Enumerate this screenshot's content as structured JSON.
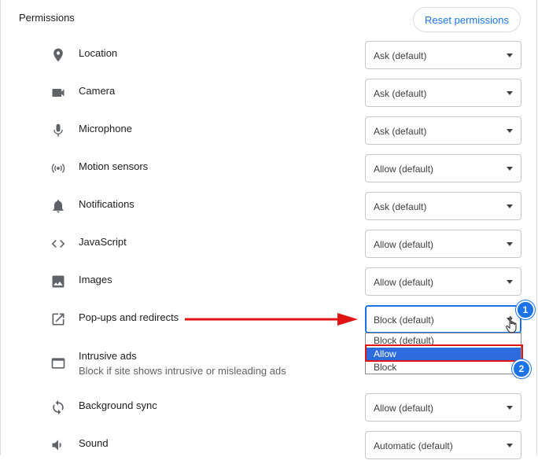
{
  "section": {
    "title": "Permissions",
    "reset_label": "Reset permissions"
  },
  "rows": [
    {
      "label": "Location",
      "value": "Ask (default)",
      "icon": "location-pin-icon"
    },
    {
      "label": "Camera",
      "value": "Ask (default)",
      "icon": "camera-icon"
    },
    {
      "label": "Microphone",
      "value": "Ask (default)",
      "icon": "microphone-icon"
    },
    {
      "label": "Motion sensors",
      "value": "Allow (default)",
      "icon": "motion-sensors-icon"
    },
    {
      "label": "Notifications",
      "value": "Ask (default)",
      "icon": "bell-icon"
    },
    {
      "label": "JavaScript",
      "value": "Allow (default)",
      "icon": "code-icon"
    },
    {
      "label": "Images",
      "value": "Allow (default)",
      "icon": "image-icon"
    },
    {
      "label": "Pop-ups and redirects",
      "value": "Block (default)",
      "icon": "external-link-icon"
    },
    {
      "label": "Intrusive ads",
      "sublabel": "Block if site shows intrusive or misleading ads",
      "icon": "ad-window-icon"
    },
    {
      "label": "Background sync",
      "value": "Allow (default)",
      "icon": "sync-icon"
    },
    {
      "label": "Sound",
      "value": "Automatic (default)",
      "icon": "speaker-icon"
    }
  ],
  "dropdown": {
    "options": [
      "Block (default)",
      "Allow",
      "Block"
    ],
    "highlighted": "Allow"
  },
  "annotations": {
    "step1": "1",
    "step2": "2",
    "arrow_color": "#e01414"
  },
  "colors": {
    "accent": "#1a73e8",
    "highlight_bg": "#2d6cdf",
    "annotation_red": "#e01414"
  }
}
